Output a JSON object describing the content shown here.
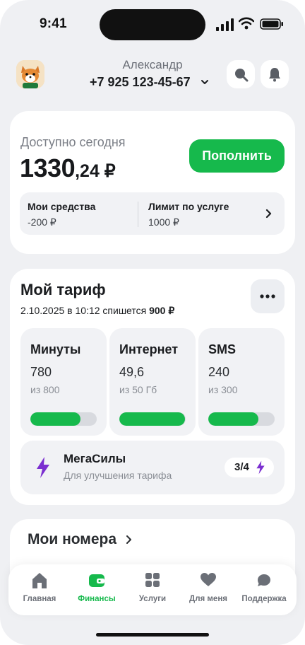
{
  "status_bar": {
    "time": "9:41"
  },
  "header": {
    "user_name": "Александр",
    "phone": "+7 925 123-45-67"
  },
  "balance": {
    "label": "Доступно сегодня",
    "amount_main": "1330",
    "amount_fraction": ",24 ₽",
    "topup_label": "Пополнить",
    "own_funds_label": "Мои средства",
    "own_funds_value": "-200 ₽",
    "limit_label": "Лимит по услуге",
    "limit_value": "1000 ₽"
  },
  "tariff": {
    "title": "Мой тариф",
    "charge_text": "2.10.2025 в 10:12 спишется",
    "charge_amount": "900 ₽",
    "tiles": [
      {
        "title": "Минуты",
        "value": "780",
        "sub": "из 800",
        "progress": 0.75
      },
      {
        "title": "Интернет",
        "value": "49,6",
        "sub": "из 50 Гб",
        "progress": 0.99
      },
      {
        "title": "SMS",
        "value": "240",
        "sub": "из 300",
        "progress": 0.75
      }
    ],
    "megasily": {
      "title": "МегаСилы",
      "subtitle": "Для улучшения тарифа",
      "count": "3/4"
    }
  },
  "numbers": {
    "title": "Мои номера"
  },
  "tabs": [
    {
      "label": "Главная",
      "icon": "home-icon",
      "active": false
    },
    {
      "label": "Финансы",
      "icon": "wallet-icon",
      "active": true
    },
    {
      "label": "Услуги",
      "icon": "grid-icon",
      "active": false
    },
    {
      "label": "Для меня",
      "icon": "heart-icon",
      "active": false
    },
    {
      "label": "Поддержка",
      "icon": "chat-icon",
      "active": false
    }
  ],
  "colors": {
    "accent": "#16b94c",
    "megasily": "#7b2fd0",
    "background": "#eff0f3"
  }
}
